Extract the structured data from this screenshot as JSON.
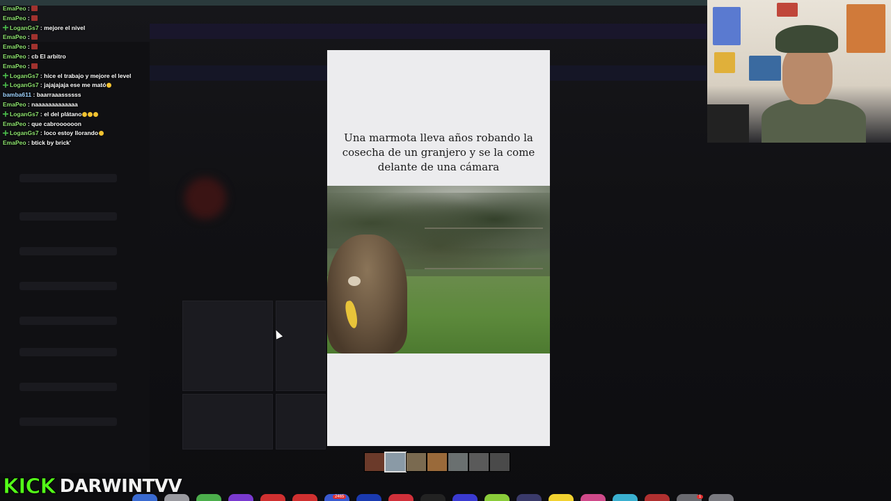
{
  "chat": {
    "lines": [
      {
        "user": "EmaPeo",
        "msg": "",
        "emote": "red-emote",
        "badge": false,
        "color": "green"
      },
      {
        "user": "EmaPeo",
        "msg": "",
        "emote": "red-emote",
        "badge": false,
        "color": "green"
      },
      {
        "user": "LoganGs7",
        "msg": "mejore el nivel",
        "emote": "",
        "badge": true,
        "color": "green"
      },
      {
        "user": "EmaPeo",
        "msg": "",
        "emote": "red-emote",
        "badge": false,
        "color": "green"
      },
      {
        "user": "EmaPeo",
        "msg": "",
        "emote": "red-emote",
        "badge": false,
        "color": "green"
      },
      {
        "user": "EmaPeo",
        "msg": "cb El arbitro",
        "emote": "",
        "badge": false,
        "color": "green"
      },
      {
        "user": "EmaPeo",
        "msg": "",
        "emote": "red-emote",
        "badge": false,
        "color": "green"
      },
      {
        "user": "LoganGs7",
        "msg": "hice el trabajo y mejore el level",
        "emote": "",
        "badge": true,
        "color": "green"
      },
      {
        "user": "LoganGs7",
        "msg": "jajajajaja ese me mató",
        "emote": "laugh-emoji",
        "badge": true,
        "color": "green"
      },
      {
        "user": "bamba611",
        "msg": "baarraaassssss",
        "emote": "",
        "badge": false,
        "color": "blue"
      },
      {
        "user": "EmaPeo",
        "msg": "naaaaaaaaaaaaa",
        "emote": "",
        "badge": false,
        "color": "green"
      },
      {
        "user": "LoganGs7",
        "msg": "el del plátano",
        "emote": "laugh-emoji-x3",
        "badge": true,
        "color": "green"
      },
      {
        "user": "EmaPeo",
        "msg": "que cabroooooon",
        "emote": "",
        "badge": false,
        "color": "green"
      },
      {
        "user": "LoganGs7",
        "msg": "loco estoy llorando",
        "emote": "laugh-emoji",
        "badge": true,
        "color": "green"
      },
      {
        "user": "EmaPeo",
        "msg": "btick by brick'",
        "emote": "",
        "badge": false,
        "color": "green"
      }
    ]
  },
  "post": {
    "headline": "Una marmota lleva años robando la cosecha de un granjero y se la come delante de una cámara",
    "image_icon": "marmot-eating-banana-photo"
  },
  "thumbnails": {
    "count": 7,
    "active_index": 1,
    "colors": [
      "#6b3a2a",
      "#8a9aa6",
      "#7a6a50",
      "#9a6a3a",
      "#6a7070",
      "#5a5a5a",
      "#4a4a4a"
    ]
  },
  "branding": {
    "platform": "KICK",
    "channel": "DARWINTVV",
    "platform_color": "#53fc18"
  },
  "dock": {
    "badges": [
      "2465",
      "1"
    ],
    "icon_colors": [
      "#3a6ad0",
      "#9a9aa0",
      "#4cae4c",
      "#7a3ad0",
      "#d03030",
      "#d03030",
      "#3a5ad0",
      "#1a3ab0",
      "#d0303a",
      "#222",
      "#3a3ad0",
      "#8acc3a",
      "#3a3a6a",
      "#f2d230",
      "#d04a8a",
      "#3ab0d0",
      "#b03030",
      "#6a6a70",
      "#7a7a80"
    ]
  },
  "accent_colors": {
    "chat_user_green": "#7fe37f",
    "chat_user_blue": "#9fd3ff",
    "modal_bg": "#ececee"
  }
}
